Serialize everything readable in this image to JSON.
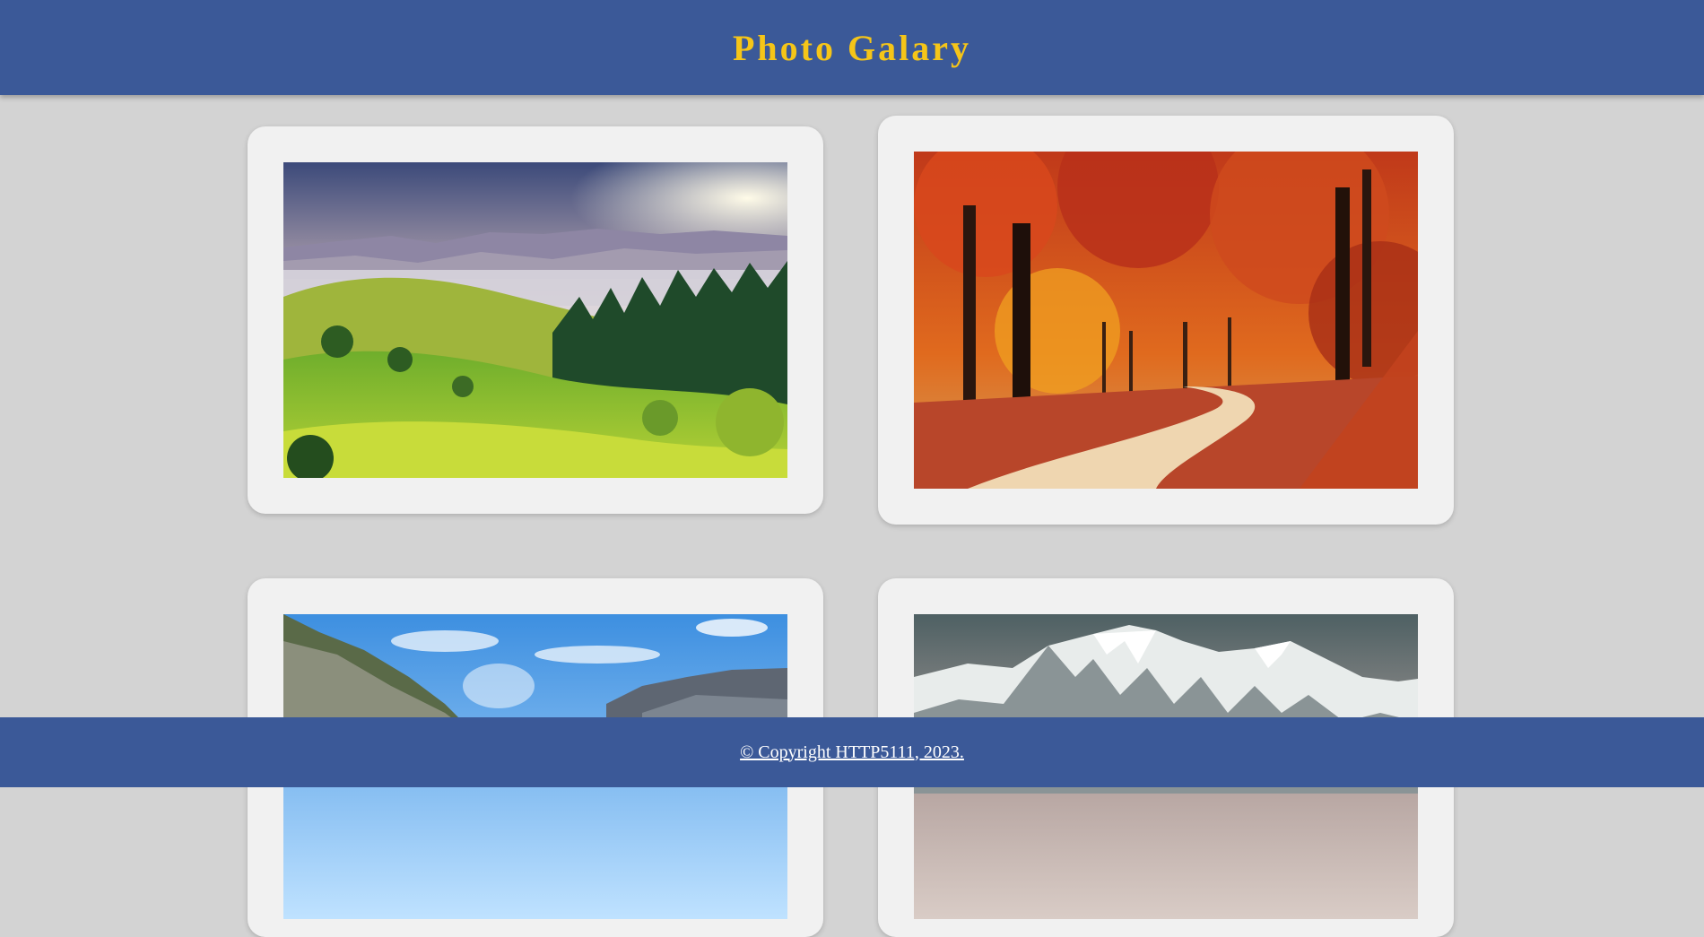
{
  "header": {
    "title": "Photo Galary",
    "title_color": "#f5c518",
    "background": "#3b5998"
  },
  "gallery": {
    "background": "#d3d3d3",
    "card_background": "#f1f1f1",
    "items": [
      {
        "subject": "green hills with misty valley at sunrise"
      },
      {
        "subject": "autumn forest with red trees and winding path"
      },
      {
        "subject": "rocky canyon under blue sky"
      },
      {
        "subject": "snow-capped mountain range"
      }
    ]
  },
  "footer": {
    "copyright": "© Copyright HTTP5111, 2023.",
    "background": "#3b5998",
    "text_color": "#ffffff"
  }
}
